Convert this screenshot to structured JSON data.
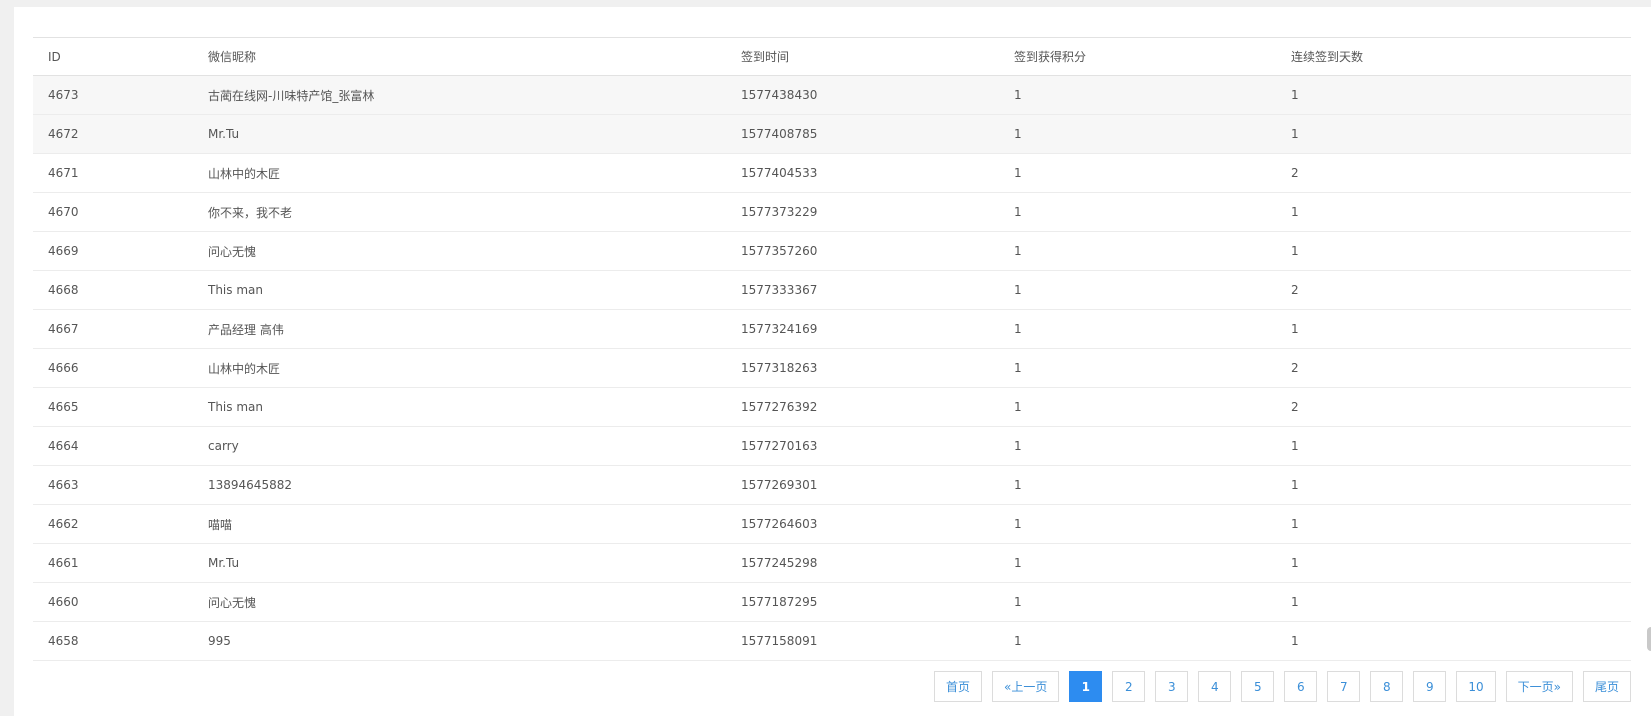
{
  "table": {
    "columns": [
      "ID",
      "微信昵称",
      "签到时间",
      "签到获得积分",
      "连续签到天数"
    ],
    "rows": [
      [
        "4673",
        "古蔺在线网-川味特产馆_张富林",
        "1577438430",
        "1",
        "1"
      ],
      [
        "4672",
        "Mr.Tu",
        "1577408785",
        "1",
        "1"
      ],
      [
        "4671",
        "山林中的木匠",
        "1577404533",
        "1",
        "2"
      ],
      [
        "4670",
        "你不来，我不老",
        "1577373229",
        "1",
        "1"
      ],
      [
        "4669",
        "问心无愧",
        "1577357260",
        "1",
        "1"
      ],
      [
        "4668",
        "This man",
        "1577333367",
        "1",
        "2"
      ],
      [
        "4667",
        "产品经理 高伟",
        "1577324169",
        "1",
        "1"
      ],
      [
        "4666",
        "山林中的木匠",
        "1577318263",
        "1",
        "2"
      ],
      [
        "4665",
        "This man",
        "1577276392",
        "1",
        "2"
      ],
      [
        "4664",
        "carry",
        "1577270163",
        "1",
        "1"
      ],
      [
        "4663",
        "13894645882",
        "1577269301",
        "1",
        "1"
      ],
      [
        "4662",
        "喵喵",
        "1577264603",
        "1",
        "1"
      ],
      [
        "4661",
        "Mr.Tu",
        "1577245298",
        "1",
        "1"
      ],
      [
        "4660",
        "问心无愧",
        "1577187295",
        "1",
        "1"
      ],
      [
        "4658",
        "995",
        "1577158091",
        "1",
        "1"
      ]
    ]
  },
  "pagination": {
    "first": "首页",
    "prev": "«上一页",
    "pages": [
      "1",
      "2",
      "3",
      "4",
      "5",
      "6",
      "7",
      "8",
      "9",
      "10"
    ],
    "current": "1",
    "next": "下一页»",
    "last": "尾页"
  },
  "colors": {
    "accent": "#2d8cf0",
    "link": "#3b8fd8"
  }
}
